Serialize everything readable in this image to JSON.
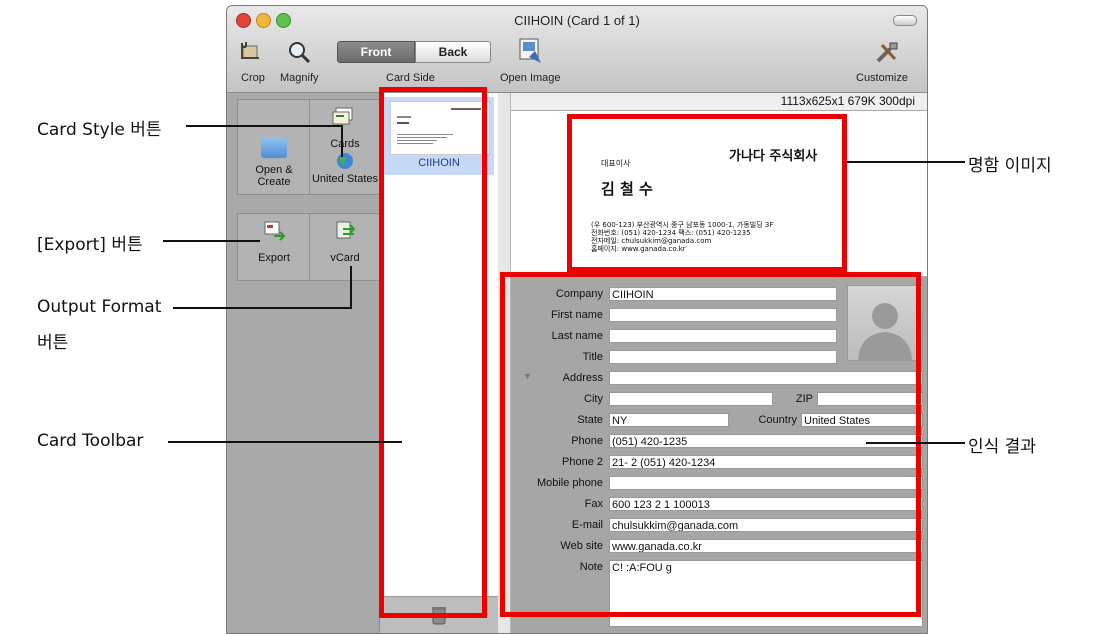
{
  "window": {
    "title": "CIIHOIN (Card 1 of 1)",
    "toolbar": {
      "crop": "Crop",
      "magnify": "Magnify",
      "card_side": "Card Side",
      "front": "Front",
      "back": "Back",
      "open_image": "Open Image",
      "customize": "Customize"
    }
  },
  "card_toolbar": {
    "open_create": "Open &\nCreate",
    "cards": "Cards",
    "country": "United States",
    "export": "Export",
    "vcard": "vCard"
  },
  "card_list": {
    "items": [
      {
        "name": "CIIHOIN"
      }
    ]
  },
  "image_info": "1113x625x1  679K  300dpi",
  "business_card": {
    "company": "가나다 주식회사",
    "position": "대표이사",
    "name": "김 철 수",
    "address_line": "(우 600-123) 부산광역시 중구 남포동 1000-1, 가동빌딩 3F",
    "phone_line": "전화번호: (051) 420-1234   팩스: (051) 420-1235",
    "email_line": "전자메일: chulsukkim@ganada.com",
    "web_line": "홈페이지: www.ganada.co.kr"
  },
  "form": {
    "labels": {
      "company": "Company",
      "first_name": "First name",
      "last_name": "Last name",
      "title": "Title",
      "address": "Address",
      "city": "City",
      "zip": "ZIP",
      "state": "State",
      "country": "Country",
      "phone": "Phone",
      "phone2": "Phone 2",
      "mobile": "Mobile phone",
      "fax": "Fax",
      "email": "E-mail",
      "website": "Web site",
      "note": "Note"
    },
    "values": {
      "company": "CIIHOIN",
      "first_name": "",
      "last_name": "",
      "title": "",
      "address": "",
      "city": "",
      "zip": "",
      "state": "NY",
      "country": "United States",
      "phone": "(051) 420-1235",
      "phone2": "21- 2 (051) 420-1234",
      "mobile": "",
      "fax": "600 123 2 1 100013",
      "email": "chulsukkim@ganada.com",
      "website": "www.ganada.co.kr",
      "note": "C! :A:FOU g"
    }
  },
  "callouts": {
    "card_style": "Card Style 버튼",
    "export": "[Export] 버튼",
    "output_format_1": "Output Format",
    "output_format_2": "버튼",
    "card_toolbar": "Card Toolbar",
    "card_image": "명함 이미지",
    "recognition": "인식 결과"
  },
  "colors": {
    "highlight_red": "#ee0000",
    "selection_blue": "#c7d9f5",
    "window_bg": "#b8b8b8"
  }
}
